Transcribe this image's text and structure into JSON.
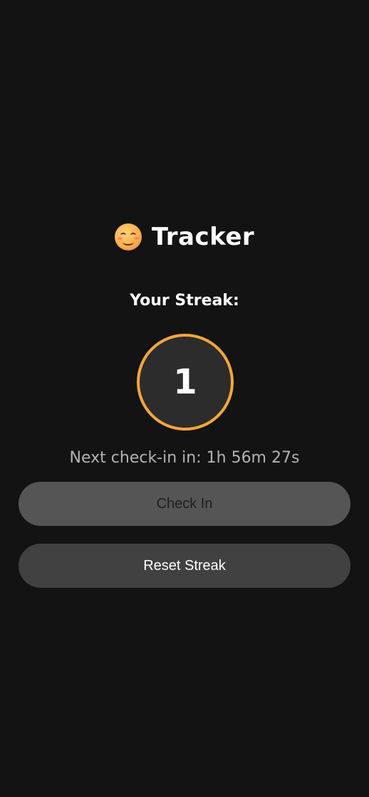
{
  "header": {
    "icon": "smiling-face-emoji",
    "title": "Tracker"
  },
  "streak": {
    "label": "Your Streak:",
    "count": "1",
    "ring_color": "#f4a63c"
  },
  "next_checkin": {
    "text": "Next check-in in: 1h 56m 27s"
  },
  "buttons": {
    "check_in": "Check In",
    "reset": "Reset Streak"
  },
  "colors": {
    "background": "#131313",
    "accent": "#f4a63c",
    "check_in_button": "#555555",
    "reset_button": "#414141"
  }
}
